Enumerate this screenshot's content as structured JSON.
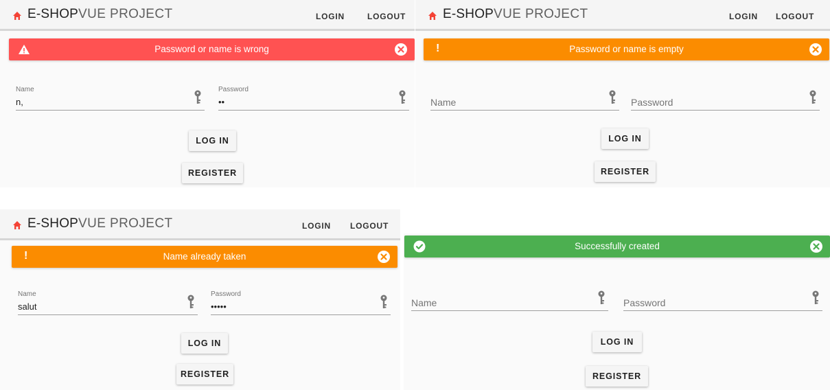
{
  "app": {
    "brand_strong": "E-SHOP",
    "brand_light": "VUE PROJECT",
    "nav_login": "LOGIN",
    "nav_logout": "LOGOUT",
    "home_icon": "home-icon",
    "brand_color": "#f44336"
  },
  "panels": [
    {
      "alert": {
        "message": "Password or name is wrong",
        "type": "error",
        "icon": "warning-icon",
        "color": "#ff5252"
      },
      "name_field": {
        "label": "Name",
        "value": "n,"
      },
      "password_field": {
        "label": "Password",
        "value": "••"
      },
      "login_label": "LOG IN",
      "register_label": "REGISTER"
    },
    {
      "alert": {
        "message": "Password or name is empty",
        "type": "warning",
        "icon": "exclamation-icon",
        "color": "#fb8c00"
      },
      "name_field": {
        "placeholder": "Name"
      },
      "password_field": {
        "placeholder": "Password"
      },
      "login_label": "LOG IN",
      "register_label": "REGISTER"
    },
    {
      "alert": {
        "message": "Name already taken",
        "type": "warning",
        "icon": "exclamation-icon",
        "color": "#fb8c00"
      },
      "name_field": {
        "label": "Name",
        "value": "salut"
      },
      "password_field": {
        "label": "Password",
        "value": "•••••"
      },
      "login_label": "LOG IN",
      "register_label": "REGISTER"
    },
    {
      "alert": {
        "message": "Successfully created",
        "type": "success",
        "icon": "check-circle-icon",
        "color": "#4caf50"
      },
      "name_field": {
        "placeholder": "Name"
      },
      "password_field": {
        "placeholder": "Password"
      },
      "login_label": "LOG IN",
      "register_label": "REGISTER"
    }
  ]
}
